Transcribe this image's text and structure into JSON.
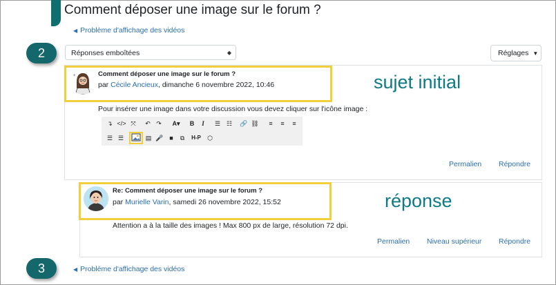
{
  "page": {
    "title": "Comment déposer une image sur le forum ?"
  },
  "nav": {
    "prev_link": "Problème d'affichage des vidéos",
    "bottom_link": "Problème d'affichage des vidéos"
  },
  "controls": {
    "display_mode": "Réponses emboîtées",
    "settings_label": "Réglages"
  },
  "callouts": {
    "step2": "2",
    "step3": "3",
    "initial_label": "sujet initial",
    "reply_label": "réponse"
  },
  "post1": {
    "subject": "Comment déposer une image sur le forum ?",
    "by": "par",
    "author": "Cécile Ancieux",
    "date": ", dimanche 6 novembre 2022, 10:46",
    "body": "Pour insérer une image dans votre discussion vous devez cliquer sur l'icône image :",
    "permalink": "Permalien",
    "reply": "Répondre"
  },
  "post2": {
    "subject": "Re: Comment déposer une image sur le forum ?",
    "by": "par",
    "author": "Murielle Varin",
    "date": ", samedi 26 novembre 2022, 15:52",
    "body": "Attention a à la taille des images ! Max 800 px de large, résolution 72 dpi.",
    "permalink": "Permalien",
    "parent": "Niveau supérieur",
    "reply": "Répondre"
  },
  "editor_toolbar": {
    "row1": [
      "↴",
      "</>",
      "⤧",
      "↶",
      "↷",
      "A▾",
      "B",
      "I",
      "☰",
      "☷",
      "🔗",
      "⛓",
      "≡",
      "≡",
      "≡"
    ],
    "row2": [
      "☰",
      "☰",
      "image",
      "▤",
      "🎤",
      "■",
      "⧉",
      "H-P",
      "⬡"
    ],
    "highlighted_icon": "image-icon"
  },
  "colors": {
    "accent": "#0f6e6e",
    "bubble": "#14676a",
    "link": "#2a6fb0",
    "highlight": "#f0cf3a",
    "annotation": "#0e7a86"
  }
}
